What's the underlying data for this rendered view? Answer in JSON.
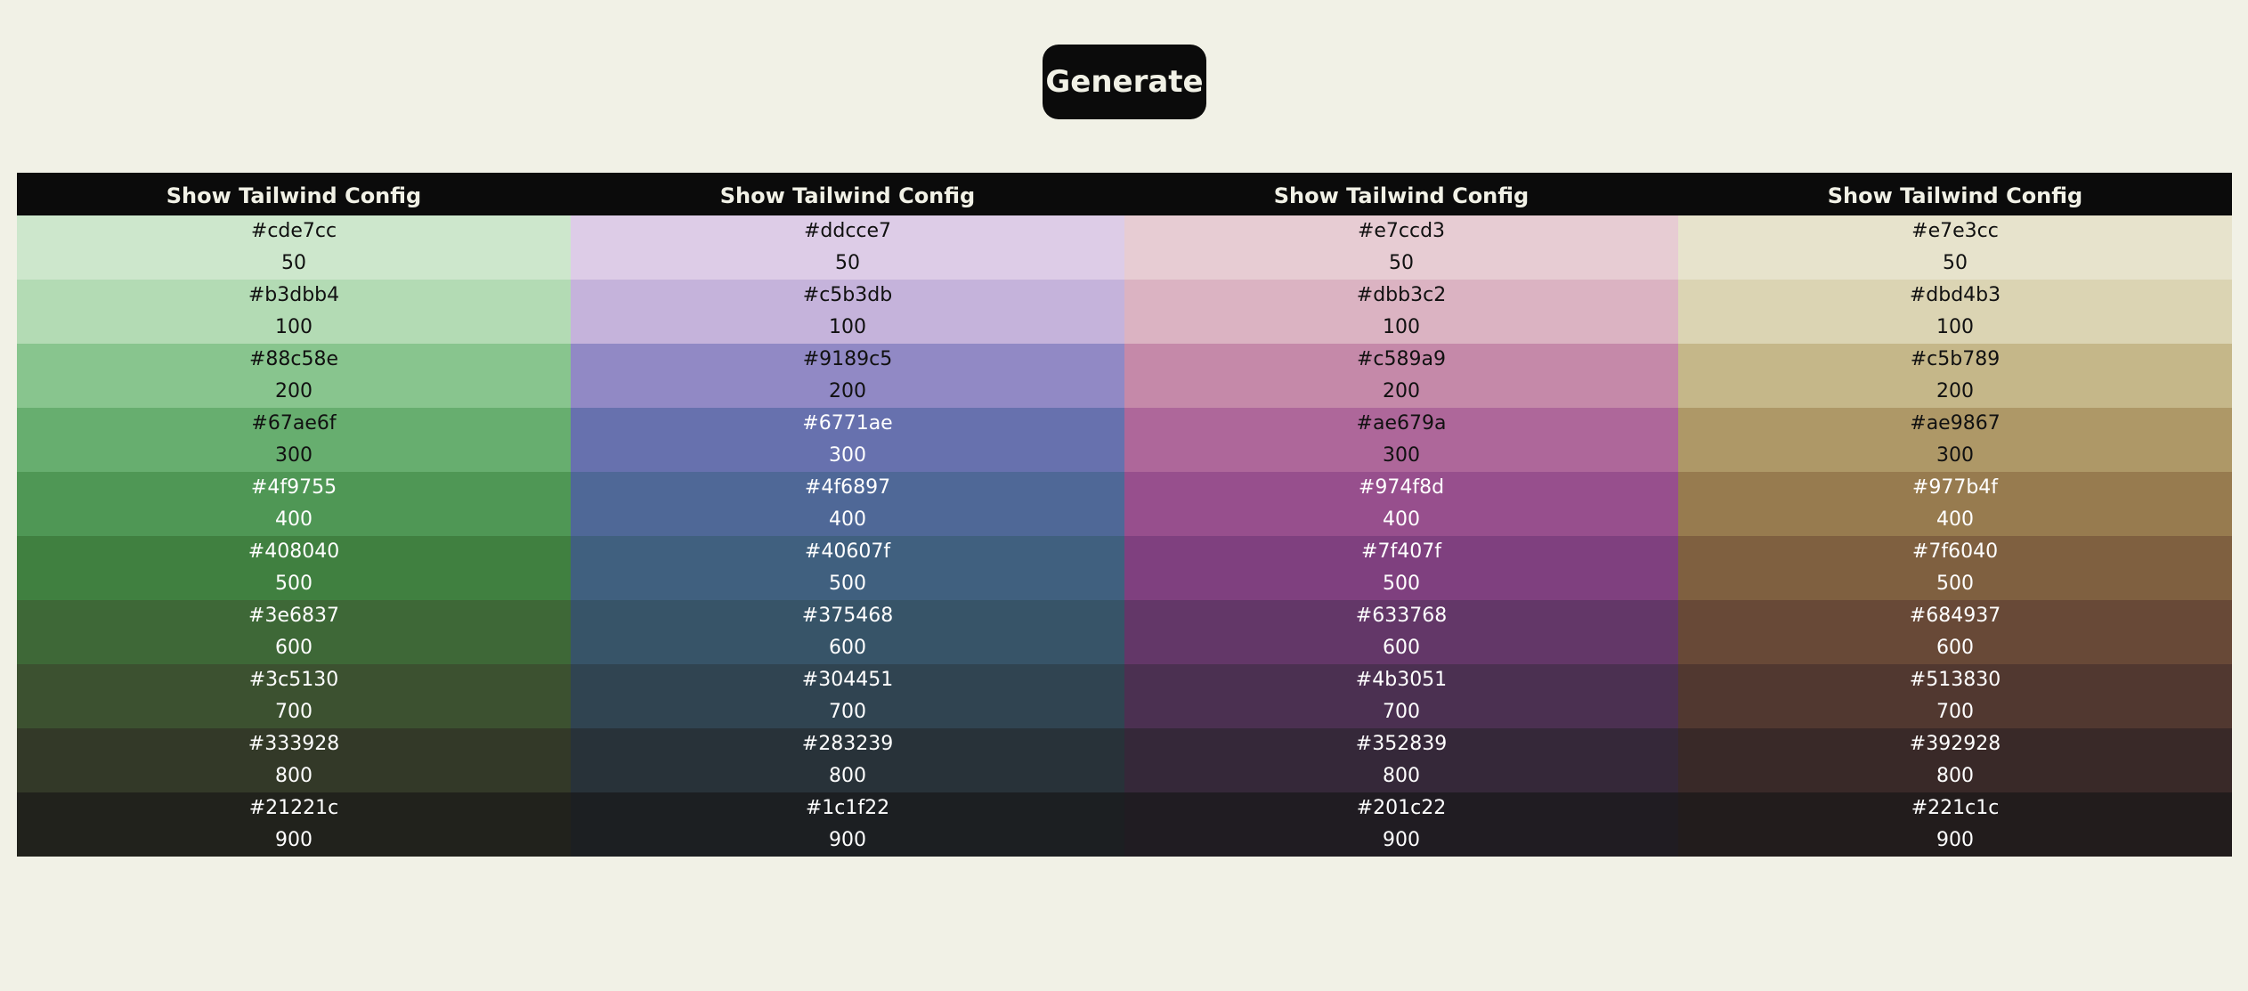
{
  "generate_label": "Generate",
  "palettes": [
    {
      "header": "Show Tailwind Config",
      "swatches": [
        {
          "hex": "#cde7cc",
          "shade": "50",
          "tone": "light"
        },
        {
          "hex": "#b3dbb4",
          "shade": "100",
          "tone": "light"
        },
        {
          "hex": "#88c58e",
          "shade": "200",
          "tone": "light"
        },
        {
          "hex": "#67ae6f",
          "shade": "300",
          "tone": "light"
        },
        {
          "hex": "#4f9755",
          "shade": "400",
          "tone": "dark"
        },
        {
          "hex": "#408040",
          "shade": "500",
          "tone": "dark"
        },
        {
          "hex": "#3e6837",
          "shade": "600",
          "tone": "dark"
        },
        {
          "hex": "#3c5130",
          "shade": "700",
          "tone": "dark"
        },
        {
          "hex": "#333928",
          "shade": "800",
          "tone": "dark"
        },
        {
          "hex": "#21221c",
          "shade": "900",
          "tone": "dark"
        }
      ]
    },
    {
      "header": "Show Tailwind Config",
      "swatches": [
        {
          "hex": "#ddcce7",
          "shade": "50",
          "tone": "light"
        },
        {
          "hex": "#c5b3db",
          "shade": "100",
          "tone": "light"
        },
        {
          "hex": "#9189c5",
          "shade": "200",
          "tone": "light"
        },
        {
          "hex": "#6771ae",
          "shade": "300",
          "tone": "dark"
        },
        {
          "hex": "#4f6897",
          "shade": "400",
          "tone": "dark"
        },
        {
          "hex": "#40607f",
          "shade": "500",
          "tone": "dark"
        },
        {
          "hex": "#375468",
          "shade": "600",
          "tone": "dark"
        },
        {
          "hex": "#304451",
          "shade": "700",
          "tone": "dark"
        },
        {
          "hex": "#283239",
          "shade": "800",
          "tone": "dark"
        },
        {
          "hex": "#1c1f22",
          "shade": "900",
          "tone": "dark"
        }
      ]
    },
    {
      "header": "Show Tailwind Config",
      "swatches": [
        {
          "hex": "#e7ccd3",
          "shade": "50",
          "tone": "light"
        },
        {
          "hex": "#dbb3c2",
          "shade": "100",
          "tone": "light"
        },
        {
          "hex": "#c589a9",
          "shade": "200",
          "tone": "light"
        },
        {
          "hex": "#ae679a",
          "shade": "300",
          "tone": "light"
        },
        {
          "hex": "#974f8d",
          "shade": "400",
          "tone": "dark"
        },
        {
          "hex": "#7f407f",
          "shade": "500",
          "tone": "dark"
        },
        {
          "hex": "#633768",
          "shade": "600",
          "tone": "dark"
        },
        {
          "hex": "#4b3051",
          "shade": "700",
          "tone": "dark"
        },
        {
          "hex": "#352839",
          "shade": "800",
          "tone": "dark"
        },
        {
          "hex": "#201c22",
          "shade": "900",
          "tone": "dark"
        }
      ]
    },
    {
      "header": "Show Tailwind Config",
      "swatches": [
        {
          "hex": "#e7e3cc",
          "shade": "50",
          "tone": "light"
        },
        {
          "hex": "#dbd4b3",
          "shade": "100",
          "tone": "light"
        },
        {
          "hex": "#c5b789",
          "shade": "200",
          "tone": "light"
        },
        {
          "hex": "#ae9867",
          "shade": "300",
          "tone": "light"
        },
        {
          "hex": "#977b4f",
          "shade": "400",
          "tone": "dark"
        },
        {
          "hex": "#7f6040",
          "shade": "500",
          "tone": "dark"
        },
        {
          "hex": "#684937",
          "shade": "600",
          "tone": "dark"
        },
        {
          "hex": "#513830",
          "shade": "700",
          "tone": "dark"
        },
        {
          "hex": "#392928",
          "shade": "800",
          "tone": "dark"
        },
        {
          "hex": "#221c1c",
          "shade": "900",
          "tone": "dark"
        }
      ]
    }
  ]
}
